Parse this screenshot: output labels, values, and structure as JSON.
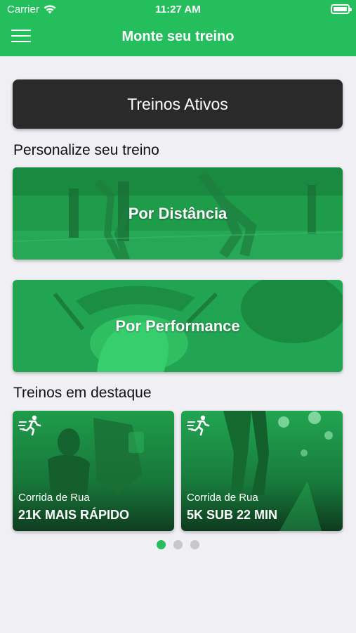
{
  "status_bar": {
    "carrier": "Carrier",
    "time": "11:27 AM",
    "wifi_icon": "wifi-icon",
    "battery_icon": "battery-icon"
  },
  "nav_bar": {
    "menu_icon": "hamburger-menu-icon",
    "title": "Monte seu treino"
  },
  "active_button": {
    "label": "Treinos Ativos"
  },
  "personalize": {
    "title": "Personalize seu treino",
    "cards": [
      {
        "label": "Por Distância"
      },
      {
        "label": "Por Performance"
      }
    ]
  },
  "featured": {
    "title": "Treinos em destaque",
    "cards": [
      {
        "category": "Corrida de Rua",
        "title": "21K MAIS RÁPIDO",
        "icon": "running-person-icon"
      },
      {
        "category": "Corrida de Rua",
        "title": "5K SUB 22 MIN",
        "icon": "running-person-icon"
      }
    ],
    "page_indicator": {
      "pages": 3,
      "current": 1
    }
  },
  "colors": {
    "brand_green": "#24bf5c",
    "dark_button": "#2a2a2a",
    "background": "#efeff4"
  }
}
